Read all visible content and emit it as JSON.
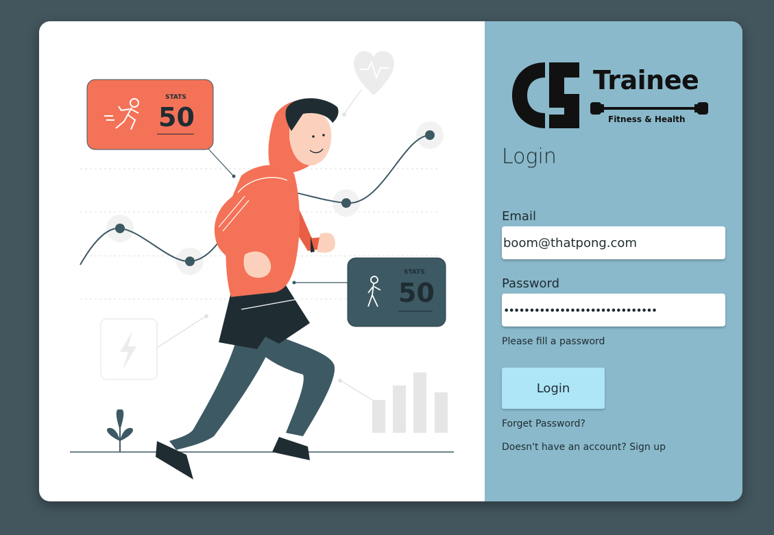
{
  "brand": {
    "name": "Trainee",
    "tagline": "Fitness & Health"
  },
  "illustration": {
    "stat_card_1": {
      "label": "STATS",
      "value": "50",
      "color": "#f47257"
    },
    "stat_card_2": {
      "label": "STATS",
      "value": "50",
      "color": "#3d5964"
    }
  },
  "login": {
    "heading": "Login",
    "email_label": "Email",
    "email_value": "boom@thatpong.com",
    "password_label": "Password",
    "password_value": "••••••••••••••••••••••••••••••",
    "password_hint": "Please fill a password",
    "submit_label": "Login",
    "forgot_password": "Forget Password?",
    "signup_prompt": "Doesn't have an account? Sign up"
  },
  "colors": {
    "background": "#43565e",
    "panel": "#8ab9cb",
    "button": "#aee6f8",
    "accent_orange": "#f47257",
    "accent_dark": "#3d5964"
  }
}
